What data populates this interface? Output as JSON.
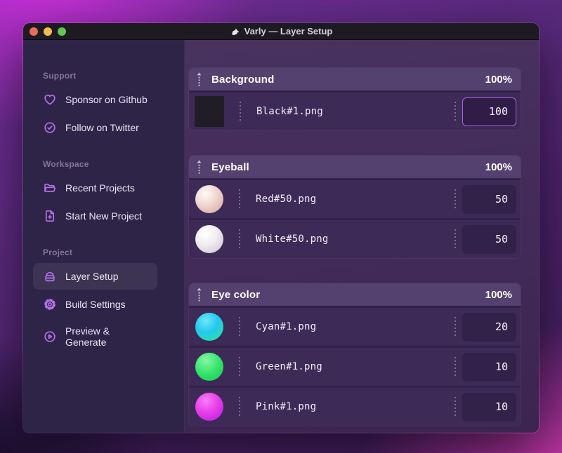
{
  "window": {
    "title": "Varly — Layer Setup",
    "app_icon": "unicorn-icon",
    "traffic_lights": [
      "close",
      "minimize",
      "zoom"
    ]
  },
  "sidebar": {
    "sections": [
      {
        "label": "Support",
        "items": [
          {
            "icon": "heart-icon",
            "label": "Sponsor on Github"
          },
          {
            "icon": "badge-check-icon",
            "label": "Follow on Twitter"
          }
        ]
      },
      {
        "label": "Workspace",
        "items": [
          {
            "icon": "folder-icon",
            "label": "Recent Projects"
          },
          {
            "icon": "file-plus-icon",
            "label": "Start New Project"
          }
        ]
      },
      {
        "label": "Project",
        "items": [
          {
            "icon": "archive-icon",
            "label": "Layer Setup",
            "selected": true
          },
          {
            "icon": "gear-icon",
            "label": "Build Settings"
          },
          {
            "icon": "play-circle-icon",
            "label": "Preview & Generate"
          }
        ]
      }
    ]
  },
  "layers": {
    "groups": [
      {
        "name": "Background",
        "weight": "100%",
        "items": [
          {
            "file": "Black#1.png",
            "value": "100",
            "thumb": "black-square",
            "focused": true
          }
        ]
      },
      {
        "name": "Eyeball",
        "weight": "100%",
        "items": [
          {
            "file": "Red#50.png",
            "value": "50",
            "thumb": "red-sphere"
          },
          {
            "file": "White#50.png",
            "value": "50",
            "thumb": "white-sphere"
          }
        ]
      },
      {
        "name": "Eye color",
        "weight": "100%",
        "items": [
          {
            "file": "Cyan#1.png",
            "value": "20",
            "thumb": "cyan-sphere"
          },
          {
            "file": "Green#1.png",
            "value": "10",
            "thumb": "green-sphere"
          },
          {
            "file": "Pink#1.png",
            "value": "10",
            "thumb": "pink-sphere"
          }
        ]
      }
    ]
  },
  "colors": {
    "accent_purple": "#b671ea",
    "focus_border": "#b15fe4",
    "sidebar_bg": "#2e2447",
    "group_header_bg": "#55416f",
    "row_bg": "#3d2a57",
    "titlebar_bg": "#1d1a21",
    "traffic_red": "#ec6a5e",
    "traffic_yellow": "#f5bd4f",
    "traffic_green": "#61c455"
  }
}
